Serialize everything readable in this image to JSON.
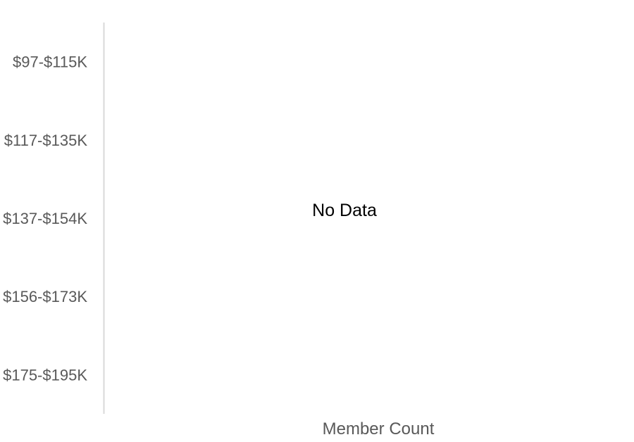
{
  "chart_data": {
    "type": "bar",
    "orientation": "horizontal",
    "categories": [
      "$97-$115K",
      "$117-$135K",
      "$137-$154K",
      "$156-$173K",
      "$175-$195K"
    ],
    "series": [],
    "xlabel": "Member Count",
    "ylabel": "",
    "grid": false,
    "empty_message": "No Data"
  },
  "colors": {
    "axis_line": "#d9d9d9",
    "tick_text": "#595959",
    "message_text": "#000000"
  }
}
